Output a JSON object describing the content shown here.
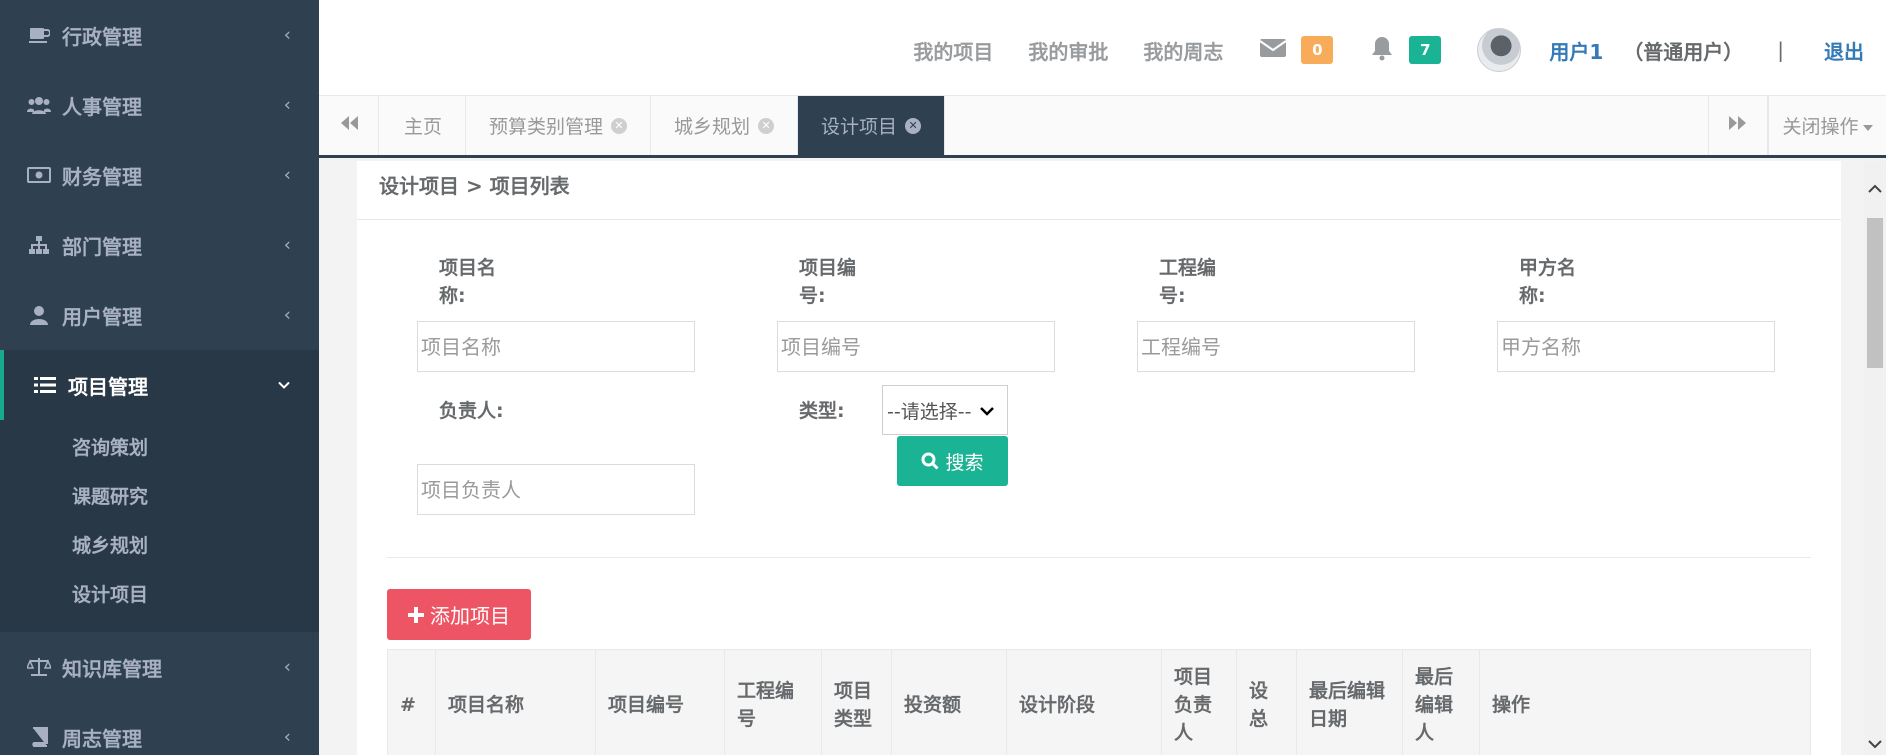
{
  "sidebar": {
    "items": [
      {
        "label": "行政管理",
        "icon": "coffee-icon"
      },
      {
        "label": "人事管理",
        "icon": "users-icon"
      },
      {
        "label": "财务管理",
        "icon": "money-icon"
      },
      {
        "label": "部门管理",
        "icon": "sitemap-icon"
      },
      {
        "label": "用户管理",
        "icon": "user-icon"
      },
      {
        "label": "项目管理",
        "icon": "list-icon"
      },
      {
        "label": "知识库管理",
        "icon": "balance-scale-icon"
      },
      {
        "label": "周志管理",
        "icon": "book-icon"
      }
    ],
    "submenu": [
      "咨询策划",
      "课题研究",
      "城乡规划",
      "设计项目"
    ],
    "collapsed_arrow": "‹",
    "expanded_arrow": "⌄"
  },
  "topbar": {
    "links": [
      "我的项目",
      "我的审批",
      "我的周志"
    ],
    "mail_count": "0",
    "bell_count": "7",
    "user_name": "用户1",
    "user_role": "（普通用户）",
    "separator": "|",
    "logout": "退出"
  },
  "tabs": {
    "items": [
      {
        "label": "主页",
        "closable": false
      },
      {
        "label": "预算类别管理",
        "closable": true
      },
      {
        "label": "城乡规划",
        "closable": true
      },
      {
        "label": "设计项目",
        "closable": true,
        "active": true
      }
    ],
    "close_ops": "关闭操作"
  },
  "breadcrumb": "设计项目 > 项目列表",
  "form": {
    "name_label": "项目名称:",
    "name_placeholder": "项目名称",
    "code_label": "项目编号:",
    "code_placeholder": "项目编号",
    "eng_label": "工程编号:",
    "eng_placeholder": "工程编号",
    "party_label": "甲方名称:",
    "party_placeholder": "甲方名称",
    "owner_label": "负责人:",
    "owner_placeholder": "项目负责人",
    "type_label": "类型:",
    "type_selected": "--请选择--",
    "search_button": "搜索"
  },
  "add_button": "添加项目",
  "table": {
    "columns": [
      "#",
      "项目名称",
      "项目编号",
      "工程编号",
      "项目类型",
      "投资额",
      "设计阶段",
      "项目负责人",
      "设总",
      "最后编辑日期",
      "最后编辑人",
      "操作"
    ]
  },
  "colors": {
    "sidebar_bg": "#2f4050",
    "primary": "#1ab394",
    "danger": "#ed5565",
    "warning": "#f8ac59",
    "link": "#337ab7"
  }
}
